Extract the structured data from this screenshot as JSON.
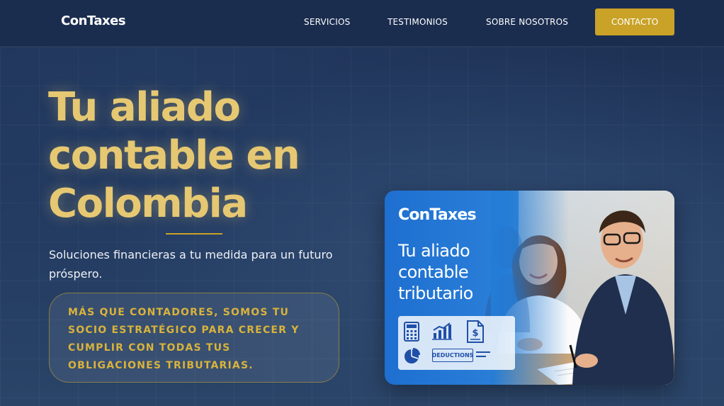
{
  "brand": {
    "name": "ConTaxes"
  },
  "nav": {
    "links": [
      "SERVICIOS",
      "TESTIMONIOS",
      "SOBRE NOSOTROS"
    ],
    "cta": "CONTACTO"
  },
  "hero": {
    "title_lines": [
      "Tu aliado",
      "contable en",
      "Colombia"
    ],
    "subtitle": "Soluciones financieras a tu medida para un futuro próspero.",
    "callout": "MÁS QUE CONTADORES, SOMOS TU SOCIO ESTRATÉGICO PARA CRECER Y CUMPLIR CON TODAS TUS OBLIGACIONES TRIBUTARIAS."
  },
  "card": {
    "logo": "ConTaxes",
    "headline_lines": [
      "Tu aliado",
      "contable",
      "tributario"
    ],
    "icons": [
      "calculator-icon",
      "bar-chart-icon",
      "document-dollar-icon",
      "pie-chart-icon"
    ],
    "deductions_label": "DEDUCTIONS"
  },
  "colors": {
    "navy": "#1b2d4f",
    "gold": "#c9a227",
    "gold_light": "#e6c872",
    "card_blue": "#1e6fd0"
  }
}
